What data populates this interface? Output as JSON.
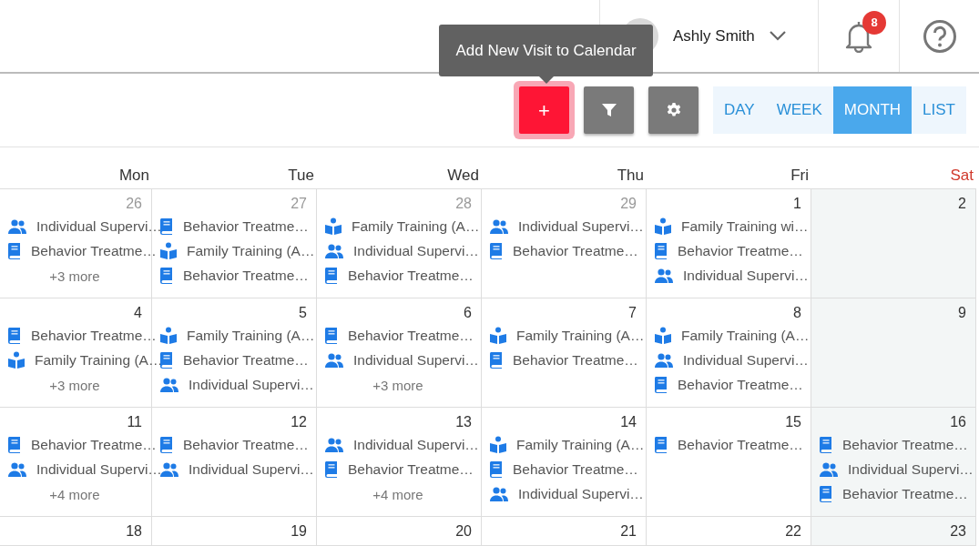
{
  "header": {
    "user_name": "Ashly Smith",
    "notification_count": "8"
  },
  "tooltip": "Add New Visit to Calendar",
  "toolbar": {
    "add_label": "+",
    "views": [
      {
        "label": "DAY",
        "selected": false
      },
      {
        "label": "WEEK",
        "selected": false
      },
      {
        "label": "MONTH",
        "selected": true
      },
      {
        "label": "LIST",
        "selected": false
      }
    ]
  },
  "calendar": {
    "weekdays": [
      {
        "label": "Mon",
        "weekend": false
      },
      {
        "label": "Tue",
        "weekend": false
      },
      {
        "label": "Wed",
        "weekend": false
      },
      {
        "label": "Thu",
        "weekend": false
      },
      {
        "label": "Fri",
        "weekend": false
      },
      {
        "label": "Sat",
        "weekend": true
      }
    ],
    "weeks": [
      [
        {
          "date": "26",
          "other_month": true,
          "events": [
            {
              "kind": "group",
              "title": "Individual Supervi…"
            },
            {
              "kind": "book",
              "title": "Behavior Treatme…"
            }
          ],
          "more": "+3 more"
        },
        {
          "date": "27",
          "other_month": true,
          "events": [
            {
              "kind": "book",
              "title": "Behavior Treatme…"
            },
            {
              "kind": "reader",
              "title": "Family Training (A…"
            },
            {
              "kind": "book",
              "title": "Behavior Treatme…"
            }
          ]
        },
        {
          "date": "28",
          "other_month": true,
          "events": [
            {
              "kind": "reader",
              "title": "Family Training (A…"
            },
            {
              "kind": "group",
              "title": "Individual Supervi…"
            },
            {
              "kind": "book",
              "title": "Behavior Treatme…"
            }
          ]
        },
        {
          "date": "29",
          "other_month": true,
          "events": [
            {
              "kind": "group",
              "title": "Individual Supervi…"
            },
            {
              "kind": "book",
              "title": "Behavior Treatme…"
            }
          ]
        },
        {
          "date": "1",
          "other_month": false,
          "events": [
            {
              "kind": "reader",
              "title": "Family Training wi…"
            },
            {
              "kind": "book",
              "title": "Behavior Treatme…"
            },
            {
              "kind": "group",
              "title": "Individual Supervi…"
            }
          ]
        },
        {
          "date": "2",
          "other_month": false
        }
      ],
      [
        {
          "date": "4",
          "other_month": false,
          "events": [
            {
              "kind": "book",
              "title": "Behavior Treatme…"
            },
            {
              "kind": "reader",
              "title": "Family Training (A…"
            }
          ],
          "more": "+3 more"
        },
        {
          "date": "5",
          "other_month": false,
          "events": [
            {
              "kind": "reader",
              "title": "Family Training (A…"
            },
            {
              "kind": "book",
              "title": "Behavior Treatme…"
            },
            {
              "kind": "group",
              "title": "Individual Supervi…"
            }
          ]
        },
        {
          "date": "6",
          "other_month": false,
          "events": [
            {
              "kind": "book",
              "title": "Behavior Treatme…"
            },
            {
              "kind": "group",
              "title": "Individual Supervi…"
            }
          ],
          "more": "+3 more"
        },
        {
          "date": "7",
          "other_month": false,
          "events": [
            {
              "kind": "reader",
              "title": "Family Training (A…"
            },
            {
              "kind": "book",
              "title": "Behavior Treatme…"
            }
          ]
        },
        {
          "date": "8",
          "other_month": false,
          "events": [
            {
              "kind": "reader",
              "title": "Family Training (A…"
            },
            {
              "kind": "group",
              "title": "Individual Supervi…"
            },
            {
              "kind": "book",
              "title": "Behavior Treatme…"
            }
          ]
        },
        {
          "date": "9",
          "other_month": false
        }
      ],
      [
        {
          "date": "11",
          "other_month": false,
          "events": [
            {
              "kind": "book",
              "title": "Behavior Treatme…"
            },
            {
              "kind": "group",
              "title": "Individual Supervi…"
            }
          ],
          "more": "+4 more"
        },
        {
          "date": "12",
          "other_month": false,
          "events": [
            {
              "kind": "book",
              "title": "Behavior Treatme…"
            },
            {
              "kind": "group",
              "title": "Individual Supervi…"
            }
          ]
        },
        {
          "date": "13",
          "other_month": false,
          "events": [
            {
              "kind": "group",
              "title": "Individual Supervi…"
            },
            {
              "kind": "book",
              "title": "Behavior Treatme…"
            }
          ],
          "more": "+4 more"
        },
        {
          "date": "14",
          "other_month": false,
          "events": [
            {
              "kind": "reader",
              "title": "Family Training (A…"
            },
            {
              "kind": "book",
              "title": "Behavior Treatme…"
            },
            {
              "kind": "group",
              "title": "Individual Supervi…"
            }
          ]
        },
        {
          "date": "15",
          "other_month": false,
          "events": [
            {
              "kind": "book",
              "title": "Behavior Treatme…"
            }
          ]
        },
        {
          "date": "16",
          "other_month": false,
          "events": [
            {
              "kind": "book",
              "title": "Behavior Treatme…"
            },
            {
              "kind": "group",
              "title": "Individual Supervi…"
            },
            {
              "kind": "book",
              "title": "Behavior Treatme…"
            }
          ]
        }
      ],
      [
        {
          "date": "18",
          "other_month": false
        },
        {
          "date": "19",
          "other_month": false
        },
        {
          "date": "20",
          "other_month": false
        },
        {
          "date": "21",
          "other_month": false
        },
        {
          "date": "22",
          "other_month": false
        },
        {
          "date": "23",
          "other_month": false
        }
      ]
    ]
  }
}
